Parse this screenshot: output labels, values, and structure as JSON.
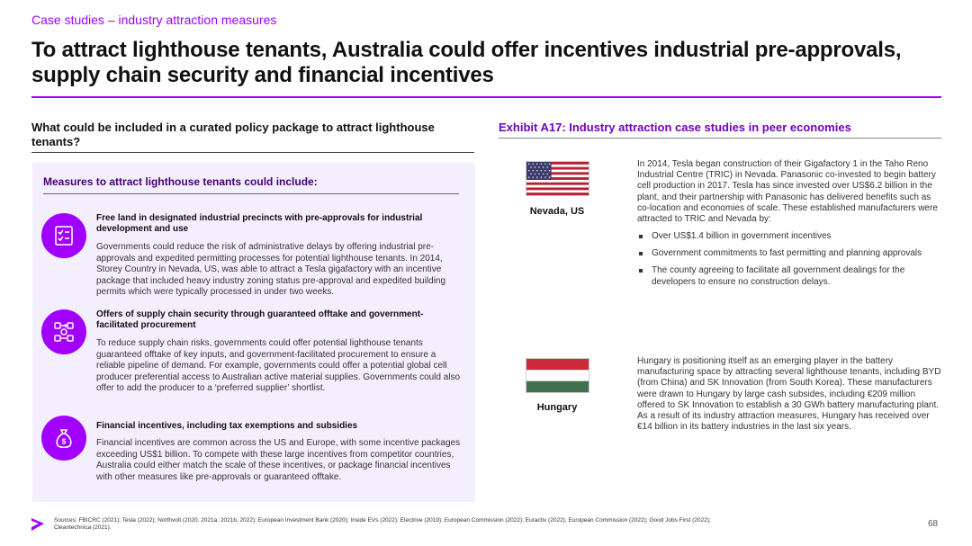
{
  "header": {
    "eyebrow": "Case studies – industry attraction measures",
    "title": "To attract lighthouse tenants, Australia could offer incentives industrial pre-approvals, supply chain security and financial incentives"
  },
  "left": {
    "question": "What could be included in a curated policy package to attract lighthouse tenants?",
    "panel_heading": "Measures to attract lighthouse tenants could include:",
    "measures": [
      {
        "icon": "checklist-icon",
        "title": "Free land in designated industrial precincts with pre-approvals for industrial development and use",
        "body": "Governments could reduce the risk of administrative delays by offering industrial pre-approvals and expedited permitting processes for potential lighthouse tenants. In 2014, Storey Country in Nevada, US, was able to attract a Tesla gigafactory with an incentive package that included heavy industry zoning status pre-approval and expedited building permits which were typically processed in under two weeks."
      },
      {
        "icon": "supply-chain-icon",
        "title": "Offers of supply chain security through guaranteed offtake and government-facilitated procurement",
        "body": "To reduce supply chain risks, governments could offer potential lighthouse tenants guaranteed offtake of key inputs, and government-facilitated procurement to ensure a reliable pipeline of demand. For example, governments could offer a potential global cell producer preferential access to Australian active material supplies. Governments could also offer to add the producer to a ‘preferred supplier’ shortlist."
      },
      {
        "icon": "money-bag-icon",
        "title": "Financial incentives, including tax exemptions and subsidies",
        "body": "Financial incentives are common across the US and Europe, with some incentive packages exceeding US$1 billion. To compete with these large incentives from competitor countries, Australia could either match the scale of these incentives, or package financial incentives with other measures like pre-approvals or guaranteed offtake."
      }
    ]
  },
  "right": {
    "exhibit_title": "Exhibit A17: Industry attraction case studies in peer economies",
    "cases": [
      {
        "label": "Nevada, US",
        "flag": "us-flag-icon",
        "text": "In 2014, Tesla began construction of their Gigafactory 1 in the Taho Reno Industrial Centre (TRIC) in Nevada. Panasonic co-invested to begin battery cell production in 2017. Tesla has since invested over US$6.2 billion in the plant, and their partnership with Panasonic has delivered benefits such as co-location and economies of scale. These established manufacturers were attracted to TRIC and Nevada by:",
        "bullets": [
          "Over US$1.4 billion in government incentives",
          "Government commitments to fast permitting and planning approvals",
          "The county agreeing to facilitate all government dealings for the developers to ensure no construction delays."
        ]
      },
      {
        "label": "Hungary",
        "flag": "hungary-flag-icon",
        "text": "Hungary is positioning itself as an emerging player in the battery manufacturing space by attracting several lighthouse tenants, including BYD (from China) and SK Innovation (from South Korea). These manufacturers were drawn to Hungary by large cash subsides, including €209 million offered to SK Innovation to establish a 30 GWh battery manufacturing plant. As a result of its industry attraction measures, Hungary has received over €14 billion in its battery industries in the last six years."
      }
    ]
  },
  "footer": {
    "sources": "Sources: FBICRC (2021); Tesla (2022); Northvolt (2020, 2021a, 2021b, 2022); European Investment Bank (2020); Inside EVs (2022); Electrive (2019); European Commission (2022); Euractiv (2022); European Commission (2022); Good Jobs First (2022); Cleantechnica (2021).",
    "page_number": "68"
  },
  "colors": {
    "accent": "#a100ff",
    "dark_purple": "#460073",
    "panel_bg": "#f4efff"
  }
}
